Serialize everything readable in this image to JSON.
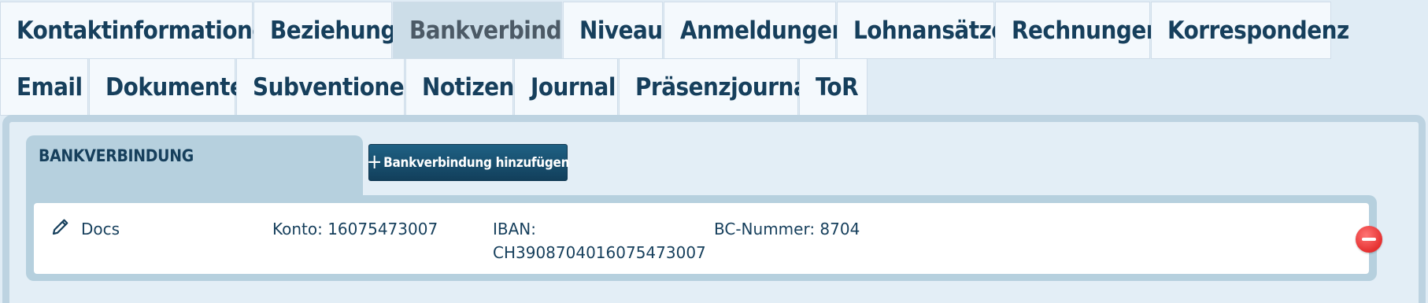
{
  "tabs_row1": [
    {
      "label": "Kontaktinformationen",
      "active": false
    },
    {
      "label": "Beziehungen",
      "active": false
    },
    {
      "label": "Bankverbindung",
      "active": true
    },
    {
      "label": "Niveau",
      "active": false
    },
    {
      "label": "Anmeldungen",
      "active": false
    },
    {
      "label": "Lohnansätze",
      "active": false
    },
    {
      "label": "Rechnungen",
      "active": false
    },
    {
      "label": "Korrespondenz",
      "active": false
    }
  ],
  "tabs_row2": [
    {
      "label": "Email",
      "active": false
    },
    {
      "label": "Dokumente",
      "active": false
    },
    {
      "label": "Subventionen",
      "active": false
    },
    {
      "label": "Notizen",
      "active": false
    },
    {
      "label": "Journal",
      "active": false
    },
    {
      "label": "Präsenzjournal",
      "active": false
    },
    {
      "label": "ToR",
      "active": false
    }
  ],
  "section": {
    "title": "BANKVERBINDUNG",
    "add_button_label": "Bankverbindung hinzufügen",
    "add_button_icon": "plus-icon"
  },
  "bank_accounts": [
    {
      "name": "Docs",
      "konto": "Konto: 16075473007",
      "iban_label": "IBAN:",
      "iban_value": "CH3908704016075473007",
      "bc_nummer": "BC-Nummer: 8704",
      "edit_icon": "pencil-icon",
      "remove_icon": "remove-icon"
    }
  ],
  "colors": {
    "primary": "#163f5c",
    "active_tab": "#ccdde8",
    "remove": "#e53030"
  }
}
